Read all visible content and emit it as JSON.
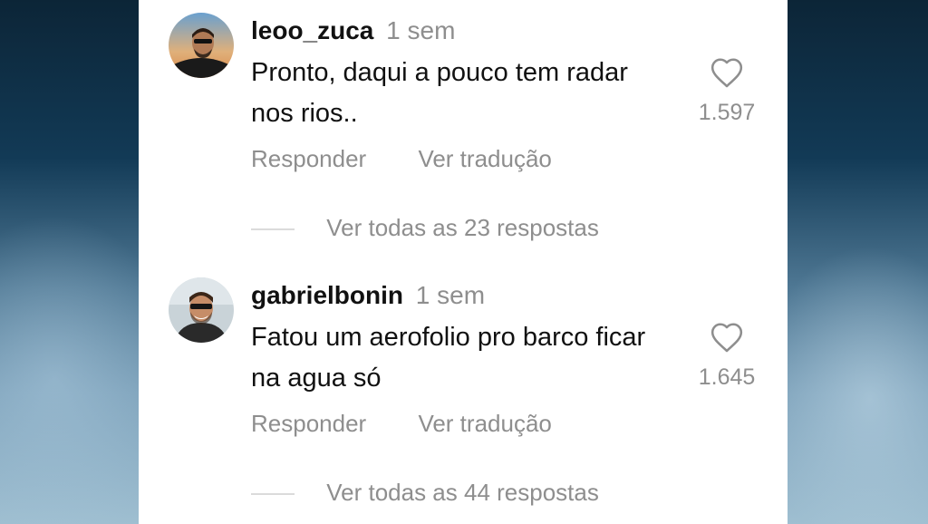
{
  "comments": [
    {
      "username": "leoo_zuca",
      "time": "1 sem",
      "text": "Pronto, daqui a pouco tem radar nos rios..",
      "likes": "1.597",
      "reply_label": "Responder",
      "translate_label": "Ver tradução",
      "view_replies": "Ver todas as 23 respostas",
      "avatar_icon": "profile-photo"
    },
    {
      "username": "gabrielbonin",
      "time": "1 sem",
      "text": "Fatou um aerofolio pro barco ficar na agua só",
      "likes": "1.645",
      "reply_label": "Responder",
      "translate_label": "Ver tradução",
      "view_replies": "Ver todas as 44 respostas",
      "avatar_icon": "profile-photo"
    }
  ],
  "icons": {
    "like": "heart-outline-icon"
  },
  "colors": {
    "text": "#111111",
    "muted": "#8e8e8e",
    "panel": "#ffffff",
    "divider": "#dbdbdb"
  }
}
